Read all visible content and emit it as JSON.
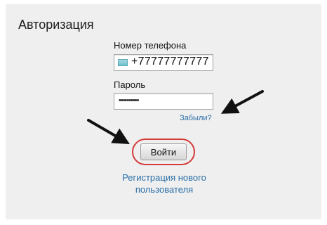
{
  "form": {
    "title": "Авторизация",
    "phone_label": "Номер телефона",
    "phone_value": "+77777777777",
    "password_label": "Пароль",
    "password_value": "••••••••••",
    "forgot_link": "Забыли?",
    "login_button": "Войти",
    "register_link_line1": "Регистрация нового",
    "register_link_line2": "пользователя"
  },
  "annotations": {
    "arrow_color": "#111111",
    "highlight_color": "#d63a3a"
  },
  "icons": {
    "phone_prefix": "country-flag-icon"
  }
}
